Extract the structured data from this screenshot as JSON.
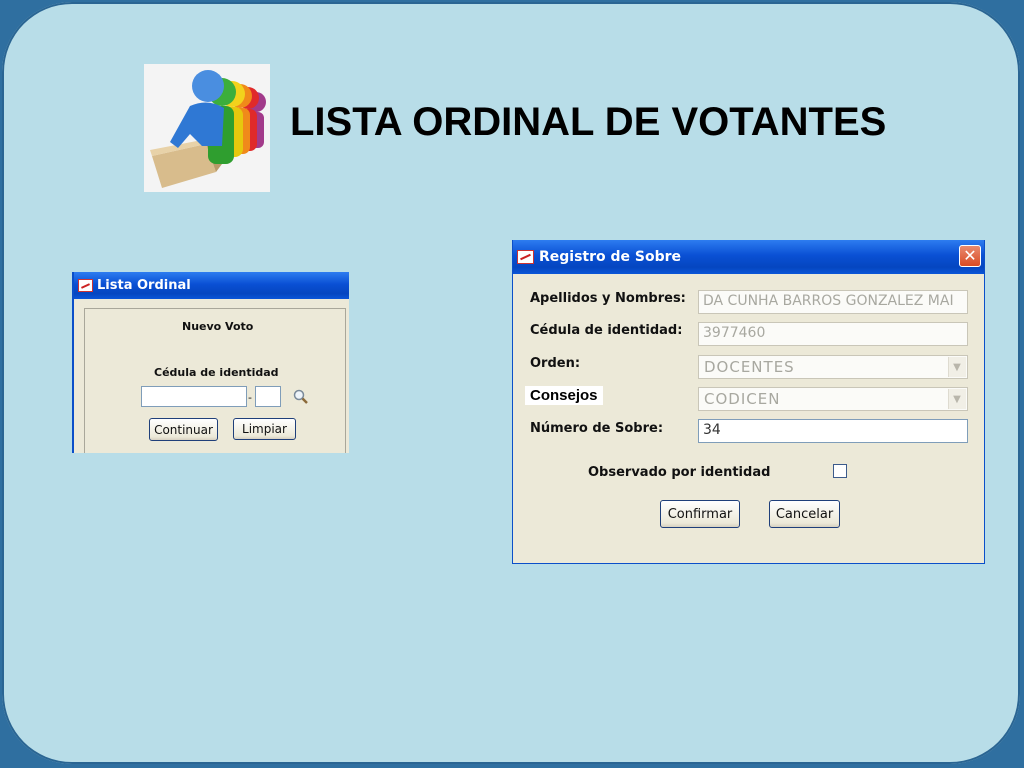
{
  "slide": {
    "title": "LISTA ORDINAL DE VOTANTES",
    "background_color": "#b8dde8",
    "frame_color": "#2f6fa0",
    "logo_icon": "voting-people-ballot-box-icon"
  },
  "lista_ordinal": {
    "window_title": "Lista Ordinal",
    "heading": "Nuevo Voto",
    "cedula_label": "Cédula de identidad",
    "cedula_value": "",
    "digit_value": "",
    "separator": "-",
    "search_icon": "magnifier-icon",
    "continuar_label": "Continuar",
    "limpiar_label": "Limpiar"
  },
  "registro_sobre": {
    "window_title": "Registro de Sobre",
    "close_glyph": "✕",
    "fields": {
      "apellidos_label": "Apellidos y Nombres:",
      "apellidos_value": "DA CUNHA BARROS GONZALEZ MAI",
      "cedula_label": "Cédula de identidad:",
      "cedula_value": "3977460",
      "orden_label": "Orden:",
      "orden_value": "DOCENTES",
      "consejos_label": "Consejos",
      "consejos_value": "CODICEN",
      "numero_label": "Número de Sobre:",
      "numero_value": "34"
    },
    "observado_label": "Observado por identidad",
    "observado_checked": false,
    "confirmar_label": "Confirmar",
    "cancelar_label": "Cancelar"
  }
}
